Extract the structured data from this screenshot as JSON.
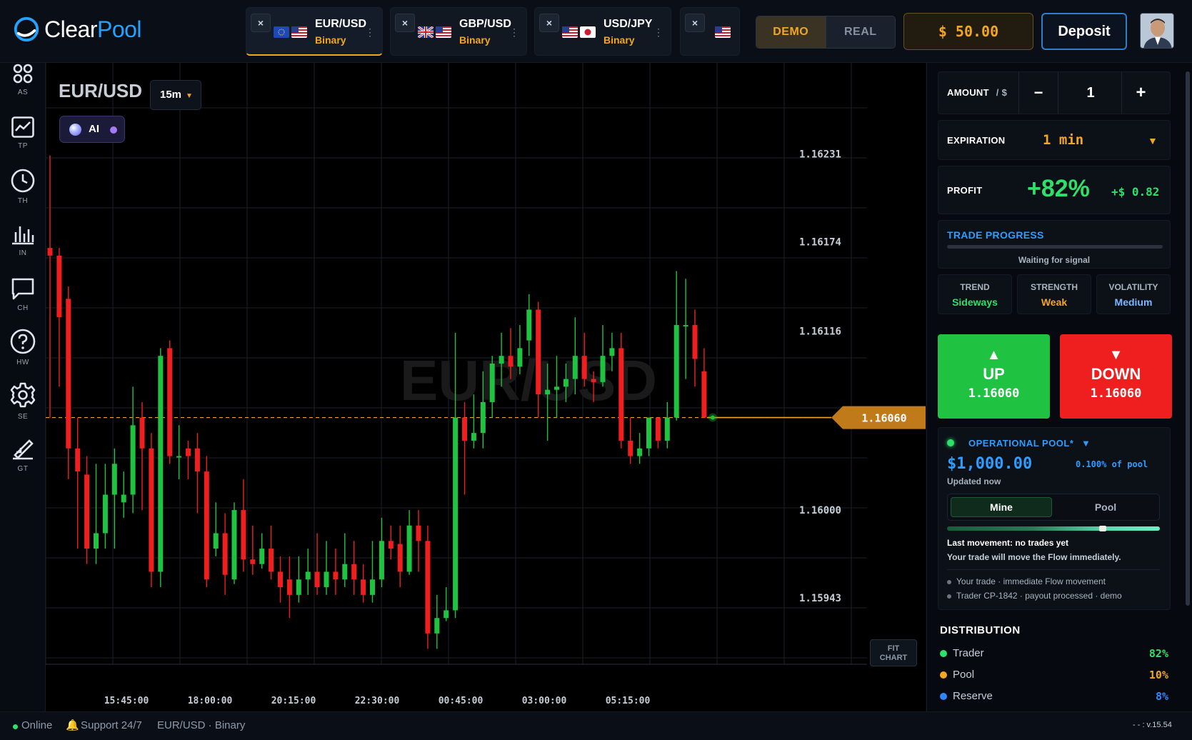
{
  "app": {
    "logo_part1": "Clear",
    "logo_part2": "Pool"
  },
  "tabs": [
    {
      "title": "EUR/USD",
      "subtitle": "Binary",
      "close": "×",
      "menu": "⋮"
    },
    {
      "title": "GBP/USD",
      "subtitle": "Binary",
      "close": "×",
      "menu": "⋮"
    },
    {
      "title": "USD/JPY",
      "subtitle": "Binary",
      "close": "×",
      "menu": "⋮"
    },
    {
      "title": "",
      "subtitle": "",
      "close": "×",
      "menu": ""
    }
  ],
  "header": {
    "demo": "DEMO",
    "real": "REAL",
    "balance": "$ 50.00",
    "deposit": "Deposit"
  },
  "sidebar": [
    {
      "label": "AS",
      "icon": "assets-icon"
    },
    {
      "label": "TP",
      "icon": "trend-chart-icon"
    },
    {
      "label": "TH",
      "icon": "clock-icon"
    },
    {
      "label": "IN",
      "icon": "bar-chart-icon"
    },
    {
      "label": "CH",
      "icon": "chat-icon"
    },
    {
      "label": "HW",
      "icon": "help-icon"
    },
    {
      "label": "SE",
      "icon": "gear-icon"
    },
    {
      "label": "GT",
      "icon": "pen-graph-icon"
    }
  ],
  "chart": {
    "pair": "EUR/USD",
    "timeframe": "15m",
    "ai_label": "AI",
    "watermark": "EUR/USD",
    "current_price": "1.16060",
    "fit_line1": "FIT",
    "fit_line2": "CHART"
  },
  "chart_data": {
    "type": "candlestick",
    "title": "EUR/USD",
    "yticks": [
      1.16231,
      1.16174,
      1.16116,
      1.16,
      1.15943
    ],
    "xticks": [
      "15:45:00",
      "18:00:00",
      "20:15:00",
      "22:30:00",
      "00:45:00",
      "03:00:00",
      "05:15:00"
    ],
    "current": 1.1606,
    "ylim": [
      1.159,
      1.1629
    ],
    "candles": [
      [
        1.1617,
        1.16165,
        1.1623,
        1.1606
      ],
      [
        1.16165,
        1.16125,
        1.1617,
        1.1608
      ],
      [
        1.16137,
        1.1604,
        1.16145,
        1.1602
      ],
      [
        1.1604,
        1.16025,
        1.1606,
        1.15975
      ],
      [
        1.16023,
        1.15975,
        1.16035,
        1.15965
      ],
      [
        1.15975,
        1.15985,
        1.1603,
        1.15965
      ],
      [
        1.15985,
        1.1601,
        1.1603,
        1.15975
      ],
      [
        1.1601,
        1.1603,
        1.1604,
        1.15975
      ],
      [
        1.16005,
        1.1601,
        1.16025,
        1.15995
      ],
      [
        1.1601,
        1.16055,
        1.1608,
        1.15998
      ],
      [
        1.1606,
        1.1604,
        1.1607,
        1.16
      ],
      [
        1.1604,
        1.1596,
        1.1605,
        1.1595
      ],
      [
        1.1596,
        1.161,
        1.16105,
        1.1595
      ],
      [
        1.16105,
        1.16035,
        1.1611,
        1.1603
      ],
      [
        1.16035,
        1.16035,
        1.16055,
        1.1602
      ],
      [
        1.1604,
        1.16035,
        1.16045,
        1.1602
      ],
      [
        1.1604,
        1.16025,
        1.1605,
        1.15998
      ],
      [
        1.16025,
        1.15955,
        1.16035,
        1.1595
      ],
      [
        1.15975,
        1.15985,
        1.16005,
        1.1597
      ],
      [
        1.15985,
        1.15958,
        1.15998,
        1.15945
      ],
      [
        1.15955,
        1.16,
        1.16005,
        1.15952
      ],
      [
        1.16,
        1.15968,
        1.1602,
        1.1596
      ],
      [
        1.15968,
        1.15965,
        1.1599,
        1.15958
      ],
      [
        1.15965,
        1.15975,
        1.15985,
        1.15962
      ],
      [
        1.15975,
        1.1596,
        1.1599,
        1.15955
      ],
      [
        1.1596,
        1.1595,
        1.1597,
        1.1594
      ],
      [
        1.15955,
        1.15945,
        1.1597,
        1.1593
      ],
      [
        1.15945,
        1.15955,
        1.1597,
        1.1594
      ],
      [
        1.15955,
        1.1596,
        1.15975,
        1.15945
      ],
      [
        1.1596,
        1.1595,
        1.15985,
        1.15945
      ],
      [
        1.1595,
        1.1596,
        1.1598,
        1.15945
      ],
      [
        1.1596,
        1.15955,
        1.15975,
        1.15945
      ],
      [
        1.15955,
        1.15965,
        1.15985,
        1.1595
      ],
      [
        1.15965,
        1.15955,
        1.1598,
        1.15945
      ],
      [
        1.15955,
        1.15945,
        1.15965,
        1.1594
      ],
      [
        1.15945,
        1.15955,
        1.1598,
        1.1594
      ],
      [
        1.15955,
        1.1598,
        1.15995,
        1.1595
      ],
      [
        1.1598,
        1.15975,
        1.1599,
        1.15968
      ],
      [
        1.15978,
        1.1596,
        1.1599,
        1.1595
      ],
      [
        1.1596,
        1.1599,
        1.16,
        1.15958
      ],
      [
        1.1599,
        1.1598,
        1.16,
        1.1596
      ],
      [
        1.1598,
        1.1592,
        1.1599,
        1.1591
      ],
      [
        1.1592,
        1.1593,
        1.15945,
        1.1591
      ],
      [
        1.1593,
        1.15935,
        1.1595,
        1.15928
      ],
      [
        1.15935,
        1.1606,
        1.16115,
        1.1593
      ],
      [
        1.1606,
        1.16045,
        1.1607,
        1.1601
      ],
      [
        1.16045,
        1.1605,
        1.16075,
        1.1604
      ],
      [
        1.1605,
        1.1607,
        1.1609,
        1.1604
      ],
      [
        1.1607,
        1.16095,
        1.161,
        1.1606
      ],
      [
        1.16095,
        1.161,
        1.16115,
        1.1608
      ],
      [
        1.161,
        1.16093,
        1.16118,
        1.16085
      ],
      [
        1.16093,
        1.16105,
        1.1612,
        1.16088
      ],
      [
        1.1611,
        1.1613,
        1.1614,
        1.161
      ],
      [
        1.1613,
        1.16075,
        1.16135,
        1.1606
      ],
      [
        1.16075,
        1.16078,
        1.16095,
        1.16045
      ],
      [
        1.16078,
        1.1608,
        1.161,
        1.1606
      ],
      [
        1.1608,
        1.16085,
        1.16095,
        1.1607
      ],
      [
        1.16085,
        1.161,
        1.16125,
        1.16075
      ],
      [
        1.161,
        1.16085,
        1.16115,
        1.1608
      ],
      [
        1.16085,
        1.16083,
        1.1609,
        1.1607
      ],
      [
        1.16083,
        1.161,
        1.1612,
        1.1608
      ],
      [
        1.161,
        1.16105,
        1.16115,
        1.1609
      ],
      [
        1.16105,
        1.16045,
        1.16115,
        1.1604
      ],
      [
        1.16045,
        1.16035,
        1.1606,
        1.1603
      ],
      [
        1.16035,
        1.1604,
        1.1605,
        1.1603
      ],
      [
        1.1604,
        1.1606,
        1.1606,
        1.16035
      ],
      [
        1.1606,
        1.16045,
        1.1606,
        1.1604
      ],
      [
        1.16045,
        1.1606,
        1.1607,
        1.1604
      ],
      [
        1.1606,
        1.1612,
        1.16155,
        1.16058
      ],
      [
        1.1612,
        1.1612,
        1.1615,
        1.16085
      ],
      [
        1.1612,
        1.16098,
        1.1613,
        1.1608
      ],
      [
        1.1609,
        1.1606,
        1.16105,
        1.1606
      ]
    ]
  },
  "trade": {
    "amount_label": "AMOUNT",
    "amount_unit": "/ $",
    "minus": "−",
    "amount": "1",
    "plus": "+",
    "expiration_label": "EXPIRATION",
    "expiration": "1 min",
    "profit_label": "PROFIT",
    "profit_pct": "+82%",
    "profit_value": "+$ 0.82",
    "progress_title": "TRADE PROGRESS",
    "progress_status": "Waiting for signal",
    "progress": 0,
    "indicators": [
      {
        "label": "TREND",
        "value": "Sideways",
        "color": "#2ee06a"
      },
      {
        "label": "STRENGTH",
        "value": "Weak",
        "color": "#f2a623"
      },
      {
        "label": "VOLATILITY",
        "value": "Medium",
        "color": "#7ab8ff"
      }
    ],
    "up_label": "UP",
    "up_price": "1.16060",
    "down_label": "DOWN",
    "down_price": "1.16060"
  },
  "pool": {
    "title": "OPERATIONAL POOL*",
    "amount": "$1,000.00",
    "share": "0.100% of pool",
    "updated": "Updated now",
    "tab_mine": "Mine",
    "tab_pool": "Pool",
    "flow_marker": 0.73,
    "last_movement": "Last movement: no trades yet",
    "note": "Your trade will move the Flow immediately.",
    "events": [
      "Your trade · immediate Flow movement",
      "Trader CP-1842 · payout processed · demo"
    ]
  },
  "distribution": {
    "title": "DISTRIBUTION",
    "rows": [
      {
        "label": "Trader",
        "value": "82%",
        "color": "#2ee06a"
      },
      {
        "label": "Pool",
        "value": "10%",
        "color": "#f2a623"
      },
      {
        "label": "Reserve",
        "value": "8%",
        "color": "#2f87ff"
      }
    ]
  },
  "status": {
    "online": "Online",
    "support": "Support 24/7",
    "context": "EUR/USD · Binary",
    "version": "- - : v.15.54"
  }
}
